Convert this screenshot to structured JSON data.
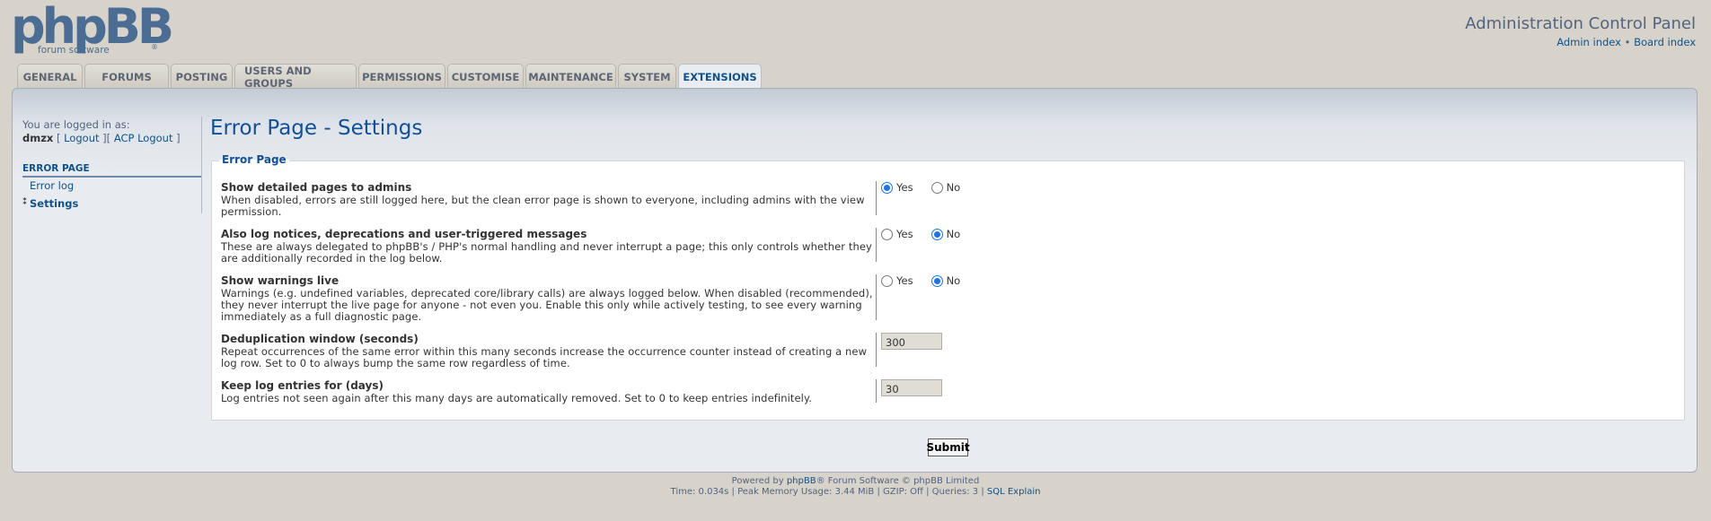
{
  "header": {
    "logo_text": "phpBB",
    "logo_sub": "forum software",
    "title": "Administration Control Panel",
    "links": {
      "admin_index": "Admin index",
      "separator": "•",
      "board_index": "Board index"
    }
  },
  "tabs": [
    {
      "label": "GENERAL"
    },
    {
      "label": "FORUMS"
    },
    {
      "label": "POSTING"
    },
    {
      "label": "USERS AND GROUPS"
    },
    {
      "label": "PERMISSIONS"
    },
    {
      "label": "CUSTOMISE"
    },
    {
      "label": "MAINTENANCE"
    },
    {
      "label": "SYSTEM"
    },
    {
      "label": "EXTENSIONS",
      "active": true
    }
  ],
  "sidebar": {
    "logged_in_as": "You are logged in as:",
    "username": "dmzx",
    "logout": "Logout",
    "acp_logout": "ACP Logout",
    "section": "ERROR PAGE",
    "items": [
      {
        "label": "Error log"
      },
      {
        "label": "Settings",
        "selected": true
      }
    ]
  },
  "main": {
    "title": "Error Page - Settings",
    "legend": "Error Page",
    "radio_yes": "Yes",
    "radio_no": "No",
    "settings": [
      {
        "title": "Show detailed pages to admins",
        "desc": "When disabled, errors are still logged here, but the clean error page is shown to everyone, including admins with the view permission.",
        "value": "Yes"
      },
      {
        "title": "Also log notices, deprecations and user-triggered messages",
        "desc": "These are always delegated to phpBB's / PHP's normal handling and never interrupt a page; this only controls whether they are additionally recorded in the log below.",
        "value": "No"
      },
      {
        "title": "Show warnings live",
        "desc": "Warnings (e.g. undefined variables, deprecated core/library calls) are always logged below. When disabled (recommended), they never interrupt the live page for anyone - not even you. Enable this only while actively testing, to see every warning immediately as a full diagnostic page.",
        "value": "No"
      },
      {
        "title": "Deduplication window (seconds)",
        "desc": "Repeat occurrences of the same error within this many seconds increase the occurrence counter instead of creating a new log row. Set to 0 to always bump the same row regardless of time.",
        "value": "300"
      },
      {
        "title": "Keep log entries for (days)",
        "desc": "Log entries not seen again after this many days are automatically removed. Set to 0 to keep entries indefinitely.",
        "value": "30"
      }
    ],
    "submit_label": "Submit"
  },
  "footer": {
    "powered_prefix": "Powered by ",
    "powered_link": "phpBB",
    "powered_suffix": "® Forum Software © phpBB Limited",
    "stats": "Time: 0.034s | Peak Memory Usage: 3.44 MiB | GZIP: Off | Queries: 3 | ",
    "sql_explain": "SQL Explain"
  },
  "colors": {
    "background": "#d7d3ca",
    "accent": "#105289",
    "title": "#115098"
  }
}
